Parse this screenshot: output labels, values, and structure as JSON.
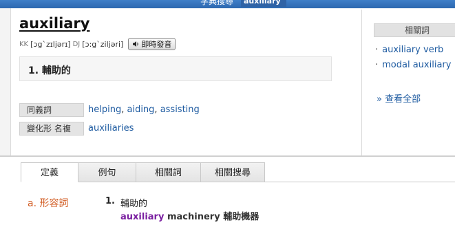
{
  "topbar": {
    "title": "字典搜尋",
    "search_value": "auxiliary"
  },
  "entry": {
    "word": "auxiliary",
    "kk_label": "KK",
    "kk": "[ɔg`zɪljərɪ]",
    "dj_label": "DJ",
    "dj": "[ɔ:g`ziljəri]",
    "sound_button": "即時發音",
    "definition": "1. 輔助的"
  },
  "info_rows": [
    {
      "label": "同義詞",
      "values": [
        "helping",
        "aiding",
        "assisting"
      ]
    },
    {
      "label": "變化形 名複",
      "values": [
        "auxiliaries"
      ]
    }
  ],
  "related": {
    "header": "相關詞",
    "items": [
      "auxiliary verb",
      "modal auxiliary"
    ],
    "view_all": "» 查看全部"
  },
  "tabs": [
    {
      "label": "定義",
      "active": true
    },
    {
      "label": "例句",
      "active": false
    },
    {
      "label": "相關詞",
      "active": false
    },
    {
      "label": "相關搜尋",
      "active": false
    }
  ],
  "definition_detail": {
    "pos": "a. 形容詞",
    "sense_number": "1.",
    "sense_text": "輔助的",
    "example_highlight": "auxiliary",
    "example_rest": " machinery 輔助機器"
  },
  "colors": {
    "link": "#1d5aa0",
    "pos": "#d15a20",
    "highlight": "#7a1fa0",
    "topbar": "#2d68b0"
  }
}
